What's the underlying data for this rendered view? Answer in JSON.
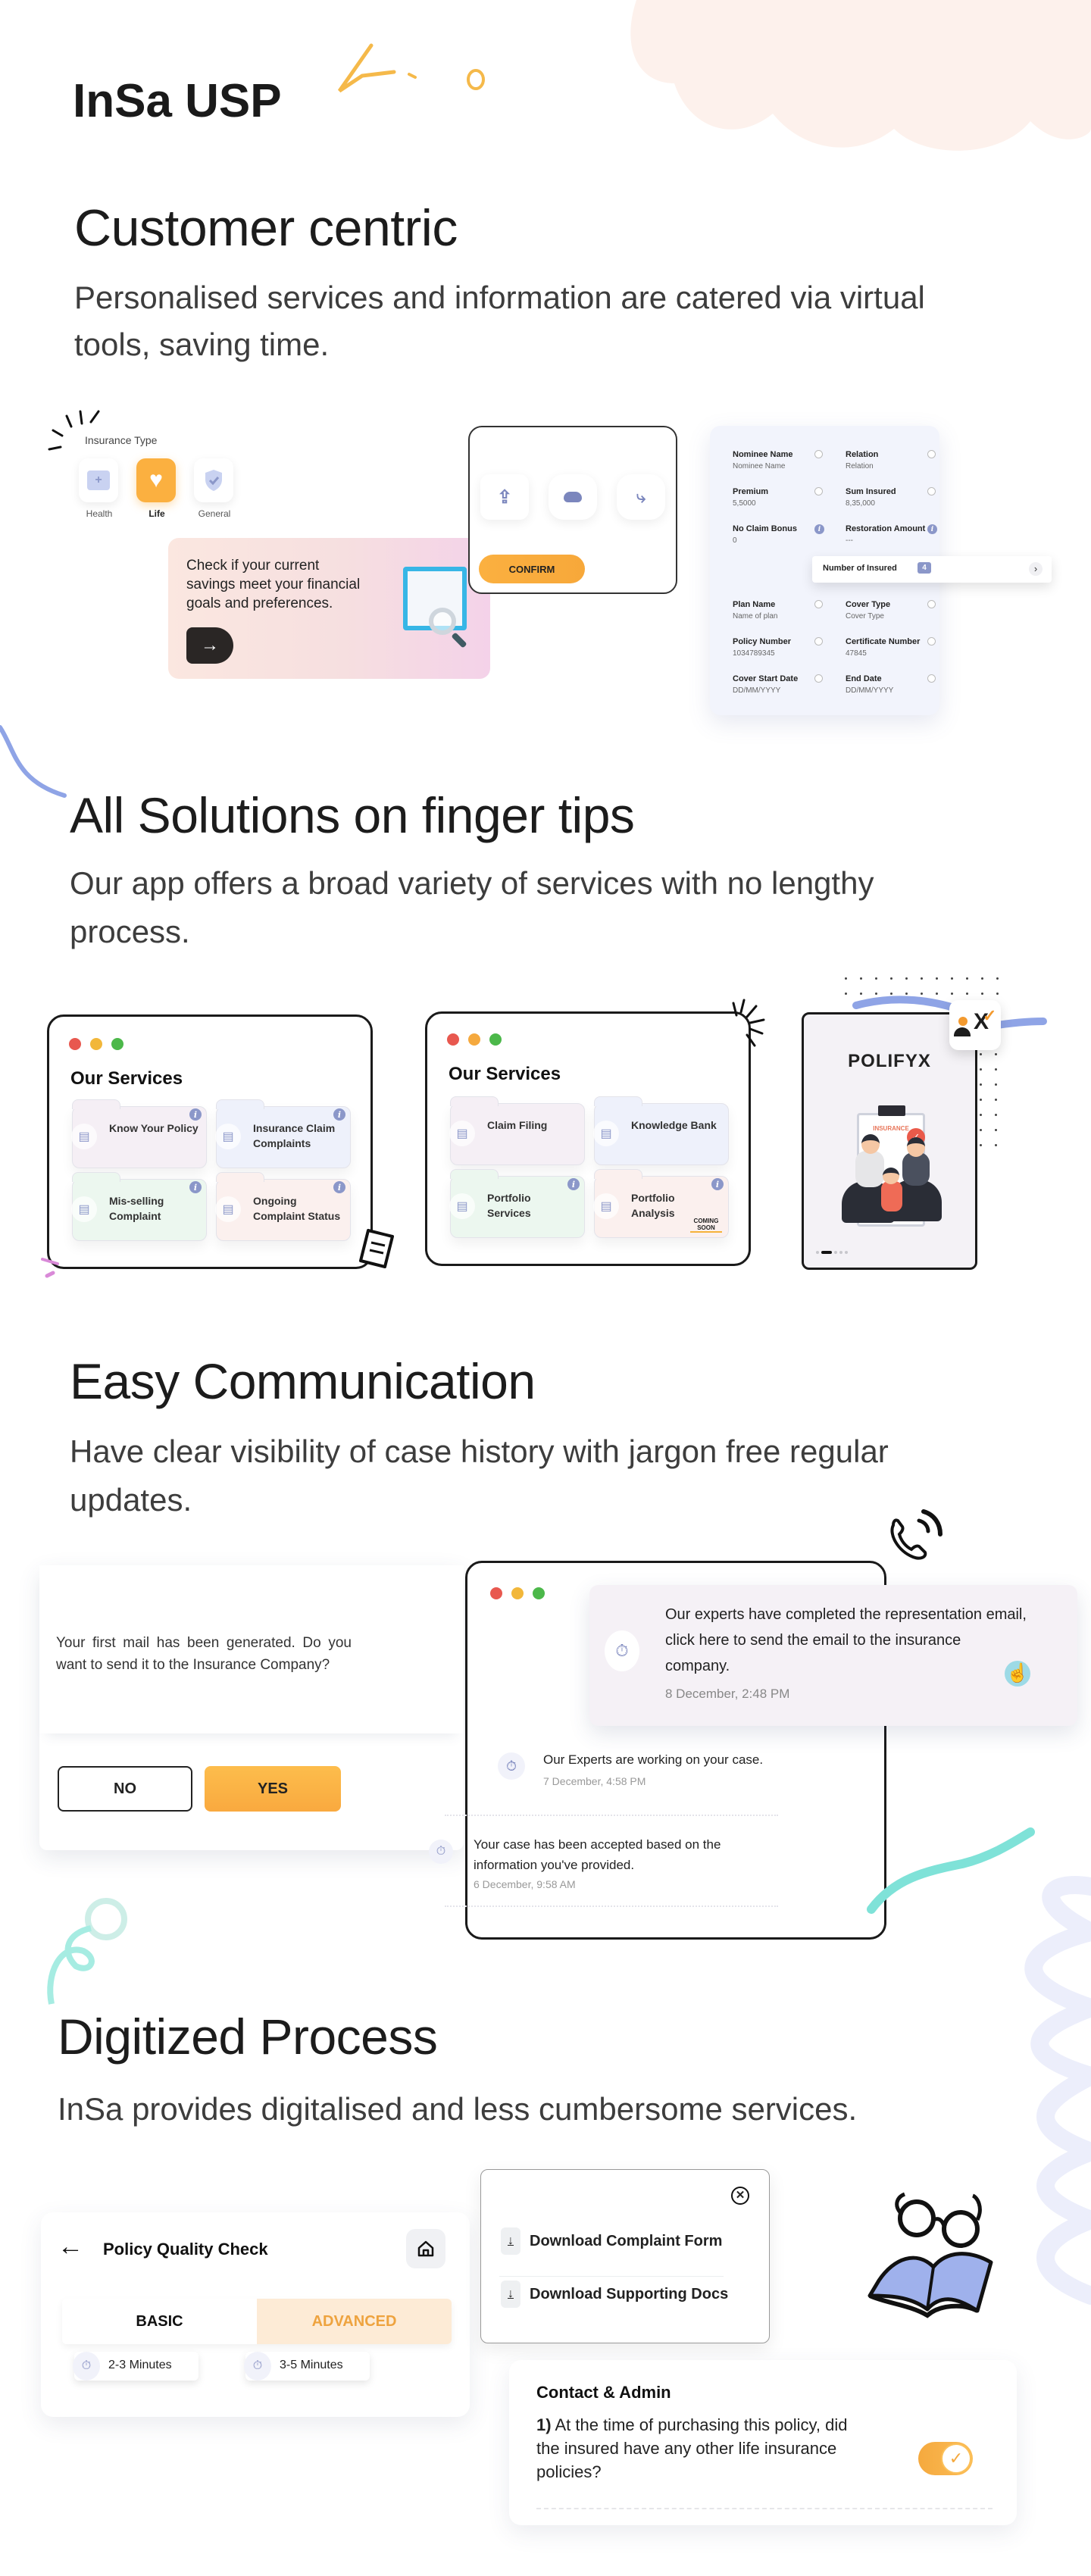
{
  "page": {
    "title": "InSa USP"
  },
  "sections": {
    "customer": {
      "title": "Customer centric",
      "subtitle": "Personalised services and information are catered via virtual tools, saving time.",
      "insurance_type": {
        "label": "Insurance Type",
        "options": [
          {
            "label": "Health",
            "icon": "medical-kit-icon",
            "selected": false
          },
          {
            "label": "Life",
            "icon": "heart-pulse-icon",
            "selected": true
          },
          {
            "label": "General",
            "icon": "shield-check-icon",
            "selected": false
          }
        ]
      },
      "savings_card": {
        "text": "Check if your current savings meet your financial goals and preferences.",
        "arrow_icon": "arrow-right-icon"
      },
      "upload_card": {
        "icons": [
          "upload-tray-icon",
          "bean-bag-icon",
          "slide-icon"
        ],
        "confirm_label": "CONFIRM"
      },
      "policy_fields": [
        {
          "label": "Nominee Name",
          "value": "Nominee Name",
          "marker": "radio"
        },
        {
          "label": "Relation",
          "value": "Relation",
          "marker": "radio"
        },
        {
          "label": "Premium",
          "value": "5,5000",
          "marker": "radio"
        },
        {
          "label": "Sum Insured",
          "value": "8,35,000",
          "marker": "radio"
        },
        {
          "label": "No Claim Bonus",
          "value": "0",
          "marker": "info"
        },
        {
          "label": "Restoration Amount",
          "value": "---",
          "marker": "info"
        },
        {
          "label": "Plan Name",
          "value": "Name of plan",
          "marker": "radio"
        },
        {
          "label": "Cover Type",
          "value": "Cover Type",
          "marker": "radio"
        },
        {
          "label": "Policy Number",
          "value": "1034789345",
          "marker": "radio"
        },
        {
          "label": "Certificate Number",
          "value": "47845",
          "marker": "radio"
        },
        {
          "label": "Cover Start Date",
          "value": "DD/MM/YYYY",
          "marker": "radio"
        },
        {
          "label": "End Date",
          "value": "DD/MM/YYYY",
          "marker": "radio"
        }
      ],
      "insured_row": {
        "label": "Number of Insured",
        "count": "4",
        "chevron": "›"
      }
    },
    "solutions": {
      "title": "All Solutions on finger tips",
      "subtitle": "Our app offers a broad variety of services with no lengthy process.",
      "window1": {
        "heading": "Our Services",
        "items": [
          {
            "label": "Know Your Policy",
            "icon": "policy-shield-icon",
            "info": true,
            "bg": "#f5eff5"
          },
          {
            "label": "Insurance Claim Complaints",
            "icon": "question-chat-icon",
            "info": true,
            "bg": "#eef1fb"
          },
          {
            "label": "Mis-selling Complaint",
            "icon": "person-question-icon",
            "info": true,
            "bg": "#ecf7ef"
          },
          {
            "label": "Ongoing Complaint Status",
            "icon": "chat-status-icon",
            "info": true,
            "bg": "#fbf0ee"
          }
        ]
      },
      "window2": {
        "heading": "Our Services",
        "items": [
          {
            "label": "Claim Filing",
            "icon": "document-pen-icon",
            "info": false,
            "bg": "#f5eff5"
          },
          {
            "label": "Knowledge Bank",
            "icon": "stars-thumb-icon",
            "info": false,
            "bg": "#eef1fb"
          },
          {
            "label": "Portfolio Services",
            "icon": "folder-check-icon",
            "info": true,
            "bg": "#ecf7ef"
          },
          {
            "label": "Portfolio Analysis",
            "icon": "chart-magnifier-icon",
            "info": true,
            "bg": "#fbf0ee",
            "badge": "COMING SOON"
          }
        ]
      },
      "phone": {
        "brand": "POLIFYX",
        "illustration_label": "INSURANCE",
        "pager": {
          "count": 5,
          "active": 1
        }
      }
    },
    "communication": {
      "title": "Easy Communication",
      "subtitle": "Have clear visibility of case history with jargon free regular updates.",
      "dialog": {
        "message": "Your first mail has been generated. Do you want to send it to the Insurance Company?",
        "no_label": "NO",
        "yes_label": "YES"
      },
      "timeline": [
        {
          "text": "Our experts have completed the representation email, click here to send the email to the insurance company.",
          "time": "8 December, 2:48 PM"
        },
        {
          "text": "Our Experts are working on your case.",
          "time": "7 December, 4:58 PM"
        },
        {
          "text": "Your case has been accepted based on the information you've provided.",
          "time": "6 December, 9:58 AM"
        }
      ]
    },
    "digitized": {
      "title": "Digitized Process",
      "subtitle": "InSa provides digitalised and less cumbersome services.",
      "quality_check": {
        "title": "Policy Quality Check",
        "tabs": [
          {
            "label": "BASIC",
            "duration": "2-3 Minutes",
            "active": false
          },
          {
            "label": "ADVANCED",
            "duration": "3-5 Minutes",
            "active": true
          }
        ]
      },
      "downloads": [
        {
          "label": "Download Complaint Form"
        },
        {
          "label": "Download Supporting Docs"
        }
      ],
      "contact": {
        "title": "Contact & Admin",
        "question_number": "1)",
        "question": "At the time of purchasing this policy, did the insured have any other life insurance policies?",
        "toggle_on": true
      }
    }
  },
  "colors": {
    "accent_orange": "#fbb040",
    "accent_blue": "#8b97c9",
    "text_dark": "#1c1c1c"
  }
}
